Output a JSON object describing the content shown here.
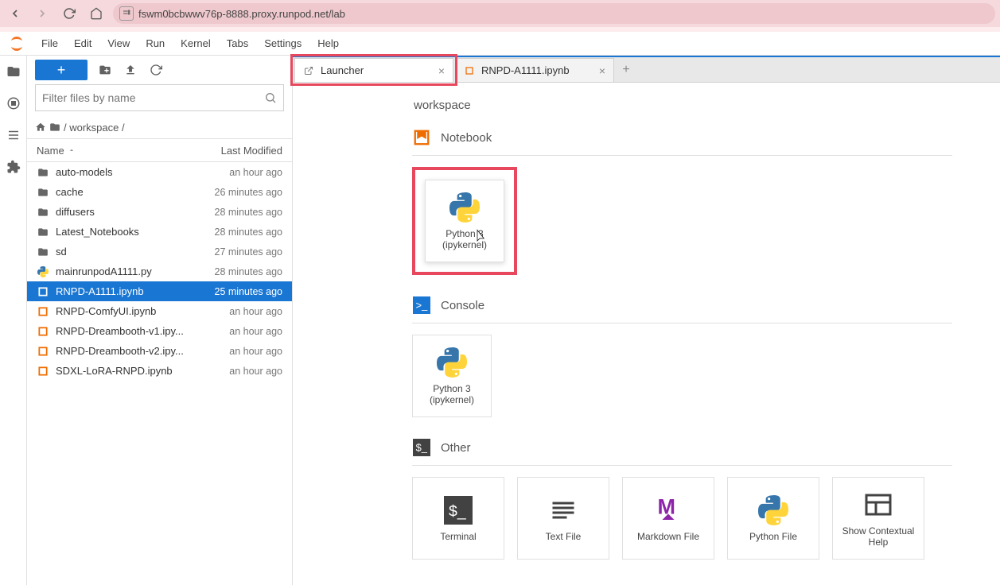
{
  "browser": {
    "url": "fswm0bcbwwv76p-8888.proxy.runpod.net/lab"
  },
  "menu": {
    "items": [
      "File",
      "Edit",
      "View",
      "Run",
      "Kernel",
      "Tabs",
      "Settings",
      "Help"
    ]
  },
  "toolbar": {
    "new_label": "+"
  },
  "filter": {
    "placeholder": "Filter files by name"
  },
  "breadcrumb": {
    "path": "/ workspace /"
  },
  "columns": {
    "name": "Name",
    "modified": "Last Modified"
  },
  "files": [
    {
      "icon": "folder",
      "name": "auto-models",
      "time": "an hour ago"
    },
    {
      "icon": "folder",
      "name": "cache",
      "time": "26 minutes ago"
    },
    {
      "icon": "folder",
      "name": "diffusers",
      "time": "28 minutes ago"
    },
    {
      "icon": "folder",
      "name": "Latest_Notebooks",
      "time": "28 minutes ago"
    },
    {
      "icon": "folder",
      "name": "sd",
      "time": "27 minutes ago"
    },
    {
      "icon": "py",
      "name": "mainrunpodA1111.py",
      "time": "28 minutes ago"
    },
    {
      "icon": "nb",
      "name": "RNPD-A1111.ipynb",
      "time": "25 minutes ago",
      "selected": true
    },
    {
      "icon": "nb",
      "name": "RNPD-ComfyUI.ipynb",
      "time": "an hour ago"
    },
    {
      "icon": "nb",
      "name": "RNPD-Dreambooth-v1.ipy...",
      "time": "an hour ago"
    },
    {
      "icon": "nb",
      "name": "RNPD-Dreambooth-v2.ipy...",
      "time": "an hour ago"
    },
    {
      "icon": "nb",
      "name": "SDXL-LoRA-RNPD.ipynb",
      "time": "an hour ago"
    }
  ],
  "tabs": [
    {
      "icon": "launch",
      "label": "Launcher",
      "active": true,
      "highlighted": true
    },
    {
      "icon": "nb",
      "label": "RNPD-A1111.ipynb",
      "active": false
    }
  ],
  "launcher": {
    "cwd": "workspace",
    "sections": {
      "notebook": {
        "title": "Notebook",
        "cards": [
          {
            "label": "Python 3\n(ipykernel)",
            "type": "python"
          }
        ]
      },
      "console": {
        "title": "Console",
        "cards": [
          {
            "label": "Python 3\n(ipykernel)",
            "type": "python"
          }
        ]
      },
      "other": {
        "title": "Other",
        "cards": [
          {
            "label": "Terminal",
            "type": "terminal"
          },
          {
            "label": "Text File",
            "type": "text"
          },
          {
            "label": "Markdown File",
            "type": "markdown"
          },
          {
            "label": "Python File",
            "type": "python"
          },
          {
            "label": "Show Contextual Help",
            "type": "help"
          }
        ]
      }
    }
  }
}
